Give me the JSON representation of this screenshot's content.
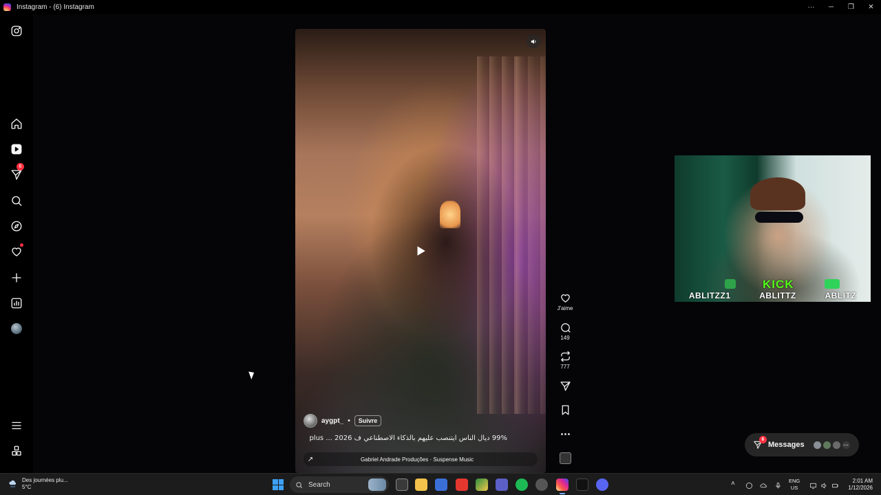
{
  "window": {
    "title": "Instagram - (6) Instagram",
    "controls": [
      "more-icon",
      "minimize-icon",
      "restore-icon",
      "close-icon"
    ]
  },
  "sidebar": {
    "items": [
      {
        "icon": "instagram-logo-icon",
        "label": "Instagram"
      },
      {
        "icon": "home-icon",
        "label": "Home"
      },
      {
        "icon": "reels-icon",
        "label": "Reels"
      },
      {
        "icon": "messages-icon",
        "label": "Messages",
        "badge": "6"
      },
      {
        "icon": "search-icon",
        "label": "Search"
      },
      {
        "icon": "explore-icon",
        "label": "Explore"
      },
      {
        "icon": "notifications-icon",
        "label": "Notifications",
        "dot": true
      },
      {
        "icon": "create-icon",
        "label": "Create"
      },
      {
        "icon": "dashboard-icon",
        "label": "Dashboard"
      },
      {
        "icon": "profile-avatar",
        "label": "Profile"
      },
      {
        "icon": "menu-icon",
        "label": "More"
      },
      {
        "icon": "also-from-meta-icon",
        "label": "Also from Meta"
      }
    ]
  },
  "reel": {
    "author": "aygpt_",
    "separator": "•",
    "follow_label": "Suivre",
    "caption": "99% ديال الناس ايتنصب عليهم بالذكاء الاصطناعي ف 2026 ... plus",
    "music": "Gabriel Andrade Produções · Suspense Music",
    "muted": false
  },
  "actions": {
    "like_label": "J'aime",
    "comments_count": "149",
    "reposts_count": "777"
  },
  "webcam": {
    "kick_label": "KICK",
    "tags": [
      "ABLITZZ1",
      "ABLITTZ",
      "ABLITZ"
    ]
  },
  "messages_pill": {
    "label": "Messages",
    "badge": "6"
  },
  "taskbar": {
    "weather_text": "Des journées plu...",
    "temperature": "5°C",
    "search_placeholder": "Search",
    "lang_top": "ENG",
    "lang_bottom": "US",
    "time": "2:01 AM",
    "date": "1/12/2026"
  },
  "colors": {
    "background": "#000000",
    "badge_red": "#ff3040",
    "kick_green": "#53fc18",
    "taskbar": "#1c1c1c"
  }
}
